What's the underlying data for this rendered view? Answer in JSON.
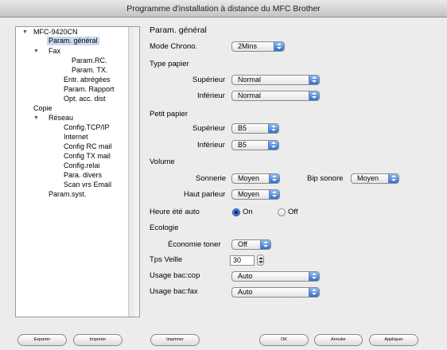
{
  "window": {
    "title": "Programme d'installation à distance du MFC Brother"
  },
  "tree": {
    "root": "MFC-9420CN",
    "items": [
      {
        "label": "Param. général",
        "selected": true
      },
      {
        "label": "Fax"
      },
      {
        "label": "Param.RC."
      },
      {
        "label": "Param. TX."
      },
      {
        "label": "Entr. abrégées"
      },
      {
        "label": "Param. Rapport"
      },
      {
        "label": "Opt. acc. dist"
      },
      {
        "label": "Copie"
      },
      {
        "label": "Réseau"
      },
      {
        "label": "Config.TCP/IP"
      },
      {
        "label": "Internet"
      },
      {
        "label": "Config RC mail"
      },
      {
        "label": "Config TX mail"
      },
      {
        "label": "Config.relai"
      },
      {
        "label": "Para. divers"
      },
      {
        "label": "Scan vrs Email"
      },
      {
        "label": "Param.syst."
      }
    ]
  },
  "panel": {
    "heading": "Param. général",
    "mode_chrono": {
      "label": "Mode Chrono.",
      "value": "2Mins"
    },
    "type_papier": {
      "label": "Type papier",
      "superieur": {
        "label": "Supérieur",
        "value": "Normal"
      },
      "inferieur": {
        "label": "Inférieur",
        "value": "Normal"
      }
    },
    "petit_papier": {
      "label": "Petit papier",
      "superieur": {
        "label": "Supérieur",
        "value": "B5"
      },
      "inferieur": {
        "label": "Inférieur",
        "value": "B5"
      }
    },
    "volume": {
      "label": "Volume",
      "sonnerie": {
        "label": "Sonnerie",
        "value": "Moyen"
      },
      "bip": {
        "label": "Bip sonore",
        "value": "Moyen"
      },
      "haut_parleur": {
        "label": "Haut parleur",
        "value": "Moyen"
      }
    },
    "heure_ete": {
      "label": "Heure été auto",
      "on": "On",
      "off": "Off",
      "selected": "On"
    },
    "ecologie": {
      "label": "Ecologie",
      "economie_toner": {
        "label": "Économie toner",
        "value": "Off"
      }
    },
    "tps_veille": {
      "label": "Tps Veille",
      "value": "30"
    },
    "usage_bac_cop": {
      "label": "Usage bac:cop",
      "value": "Auto"
    },
    "usage_bac_fax": {
      "label": "Usage bac:fax",
      "value": "Auto"
    }
  },
  "buttons": {
    "exporter": "Exporter",
    "importer": "Importer",
    "imprimer": "Imprimer",
    "ok": "OK",
    "annuler": "Annuler",
    "appliquer": "Appliquer"
  },
  "colors": {
    "selection": "#c9d9f0",
    "accent": "#2f6fd0"
  }
}
